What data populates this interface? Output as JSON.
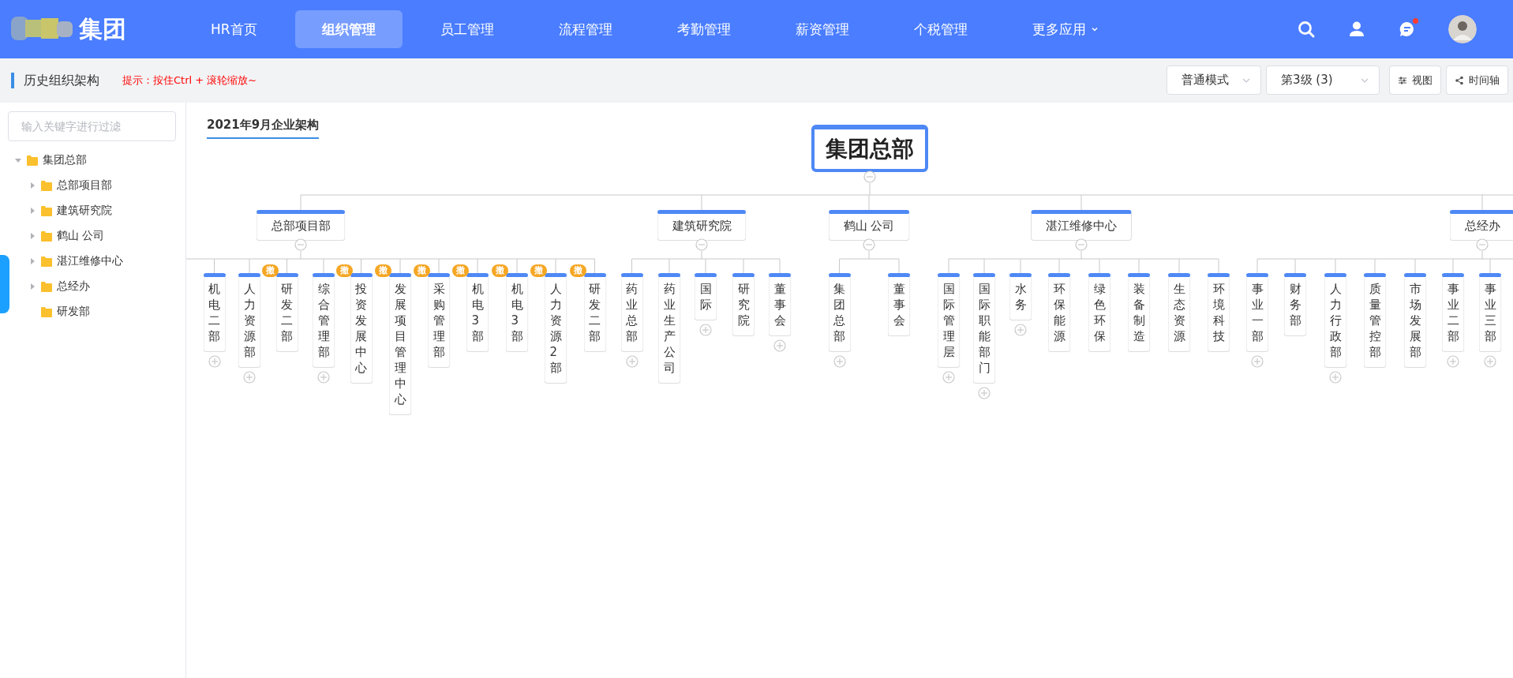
{
  "nav": {
    "logo_text": "集团",
    "items": [
      {
        "label": "HR首页",
        "selected": false,
        "kind": "link"
      },
      {
        "label": "组织管理",
        "selected": true,
        "kind": "link"
      },
      {
        "label": "员工管理",
        "selected": false,
        "kind": "link"
      },
      {
        "label": "流程管理",
        "selected": false,
        "kind": "link"
      },
      {
        "label": "考勤管理",
        "selected": false,
        "kind": "link"
      },
      {
        "label": "薪资管理",
        "selected": false,
        "kind": "link"
      },
      {
        "label": "个税管理",
        "selected": false,
        "kind": "link"
      },
      {
        "label": "更多应用",
        "selected": false,
        "kind": "dropdown"
      }
    ],
    "messages_unread": true
  },
  "page_header": {
    "title": "历史组织架构",
    "hint": "提示：按住Ctrl + 滚轮缩放~",
    "mode_select": "普通模式",
    "level_select": "第3级 (3)",
    "buttons": [
      "视图",
      "时间轴"
    ]
  },
  "sidebar": {
    "search_placeholder": "输入关键字进行过滤",
    "tree": [
      {
        "label": "集团总部",
        "expanded": true,
        "children": [
          {
            "label": "总部项目部",
            "expanded": false
          },
          {
            "label": "建筑研究院",
            "expanded": false
          },
          {
            "label": "鹤山 公司",
            "expanded": false
          },
          {
            "label": "湛江维修中心",
            "expanded": false
          },
          {
            "label": "总经办",
            "expanded": false
          },
          {
            "label": "研发部"
          }
        ]
      }
    ]
  },
  "chart": {
    "title": "2021年9月企业架构",
    "root": {
      "label": "集团总部",
      "expanded": true,
      "children": [
        {
          "label": "总部项目部",
          "expanded": true,
          "children": [
            {
              "label": "机电二部",
              "expanded": false
            },
            {
              "label": "人力资源部",
              "expanded": false
            },
            {
              "label": "研发二部",
              "badge": "撤"
            },
            {
              "label": "综合管理部",
              "expanded": false
            },
            {
              "label": "投资发展中心",
              "badge": "撤"
            },
            {
              "label": "发展项目管理中心",
              "badge": "撤"
            },
            {
              "label": "采购管理部",
              "badge": "撤"
            },
            {
              "label": "机电3部",
              "badge": "撤"
            },
            {
              "label": "机电3部",
              "badge": "撤"
            },
            {
              "label": "人力资源2部",
              "badge": "撤"
            },
            {
              "label": "研发二部",
              "badge": "撤"
            }
          ]
        },
        {
          "label": "建筑研究院",
          "expanded": true,
          "children": [
            {
              "label": "药业总部",
              "expanded": false
            },
            {
              "label": "药业生产公司"
            },
            {
              "label": "国际",
              "expanded": false
            },
            {
              "label": "研究院"
            },
            {
              "label": "董事会",
              "expanded": false
            }
          ]
        },
        {
          "label": "鹤山 公司",
          "expanded": true,
          "children": [
            {
              "label": "集团总部",
              "expanded": false
            },
            {
              "label": "董事会"
            }
          ]
        },
        {
          "label": "湛江维修中心",
          "expanded": true,
          "children": [
            {
              "label": "国际管理层",
              "expanded": false
            },
            {
              "label": "国际职能部门",
              "expanded": false
            },
            {
              "label": "水务",
              "expanded": false
            },
            {
              "label": "环保能源"
            },
            {
              "label": "绿色环保"
            },
            {
              "label": "装备制造"
            },
            {
              "label": "生态资源"
            },
            {
              "label": "环境科技"
            }
          ]
        },
        {
          "label": "总经办",
          "expanded": true,
          "children": [
            {
              "label": "事业一部",
              "expanded": false
            },
            {
              "label": "财务部"
            },
            {
              "label": "人力行政部",
              "expanded": false
            },
            {
              "label": "质量管控部"
            },
            {
              "label": "市场发展部"
            },
            {
              "label": "事业二部",
              "expanded": false
            },
            {
              "label": "事业三部",
              "expanded": false
            }
          ]
        }
      ]
    }
  }
}
